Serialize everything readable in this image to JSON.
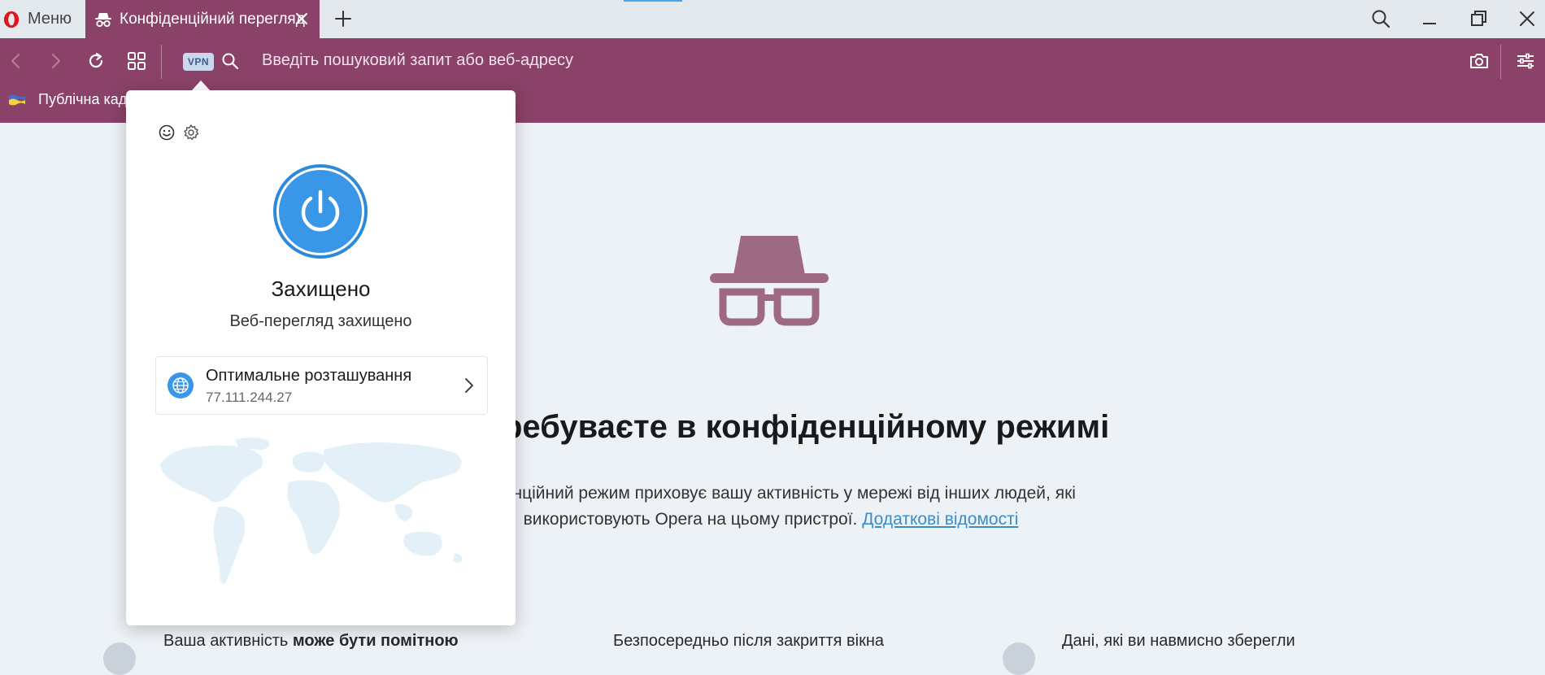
{
  "tabstrip": {
    "menu_label": "Меню",
    "tab_title": "Конфіденційний перегляд",
    "icons": [
      "opera-logo-icon",
      "incognito-icon",
      "close-icon",
      "plus-icon",
      "search-icon",
      "minimize-icon",
      "restore-icon",
      "close-window-icon"
    ]
  },
  "toolbar": {
    "vpn_label": "VPN",
    "address_placeholder": "Введіть пошуковий запит або веб-адресу",
    "bookmark_label": "Публічна кад",
    "icons": [
      "back-icon",
      "forward-icon",
      "reload-icon",
      "speed-dial-icon",
      "search-icon",
      "camera-icon",
      "easy-setup-icon"
    ]
  },
  "vpn_popup": {
    "status": "Захищено",
    "subtitle": "Веб-перегляд захищено",
    "location_name": "Оптимальне розташування",
    "ip": "77.111.244.27",
    "connected": true
  },
  "page": {
    "heading": "ребуваєте в конфіденційному режимі",
    "description": "нфіденційний режим приховує вашу активність у мережі від інших людей, які використовують Opera на цьому пристрої.",
    "link": "Додаткові відомості",
    "feature1_prefix": "Ваша активність ",
    "feature1_bold": "може бути помітною",
    "feature2": "Безпосередньо після закриття вікна",
    "feature3": "Дані, які ви навмисно зберегли"
  },
  "colors": {
    "private_accent": "#8a4268",
    "vpn_blue": "#3a96e6",
    "link": "#3a8dc8"
  }
}
